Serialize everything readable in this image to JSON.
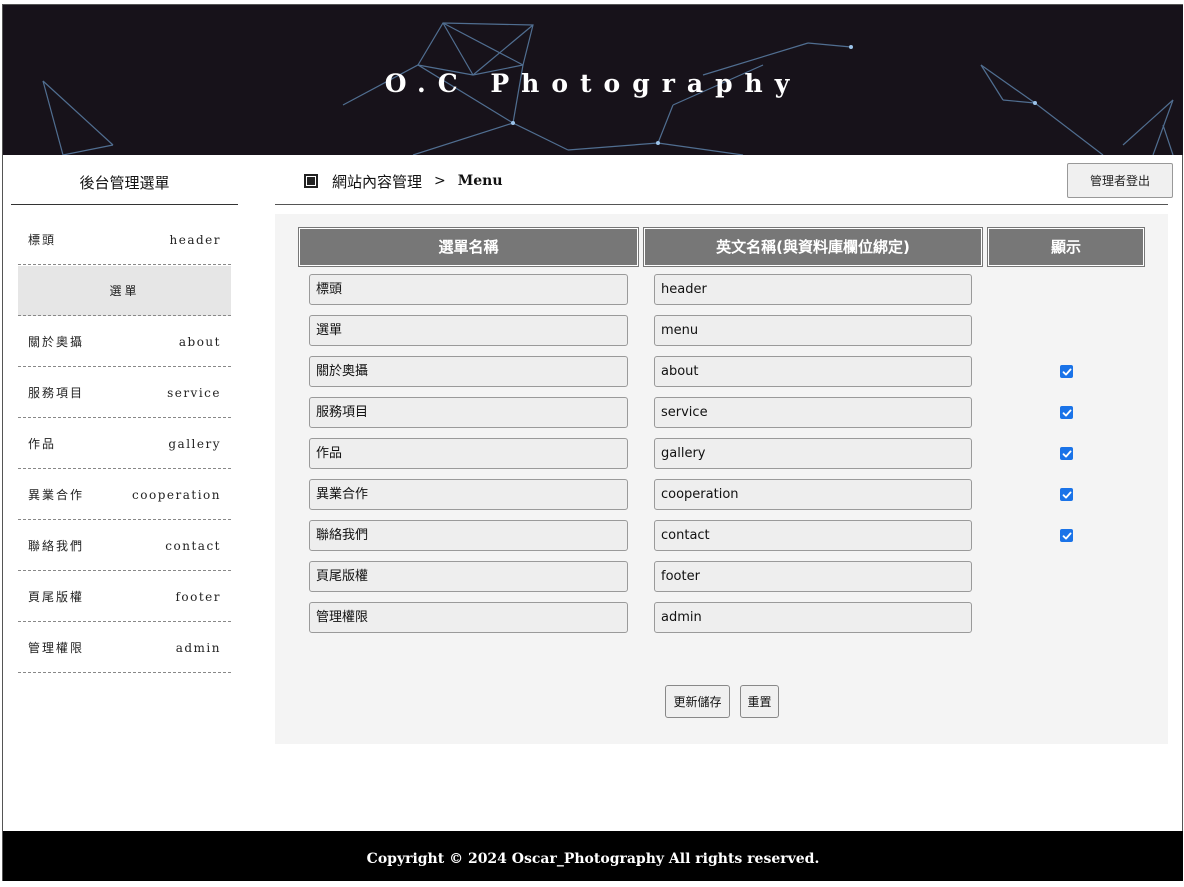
{
  "site": {
    "title": "O.C Photography"
  },
  "sidebar": {
    "title": "後台管理選單",
    "items": [
      {
        "zh": "標頭",
        "en": "header",
        "active": false
      },
      {
        "zh": "選單",
        "en": "",
        "active": true
      },
      {
        "zh": "關於奧攝",
        "en": "about",
        "active": false
      },
      {
        "zh": "服務項目",
        "en": "service",
        "active": false
      },
      {
        "zh": "作品",
        "en": "gallery",
        "active": false
      },
      {
        "zh": "異業合作",
        "en": "cooperation",
        "active": false
      },
      {
        "zh": "聯絡我們",
        "en": "contact",
        "active": false
      },
      {
        "zh": "頁尾版權",
        "en": "footer",
        "active": false
      },
      {
        "zh": "管理權限",
        "en": "admin",
        "active": false
      }
    ]
  },
  "breadcrumb": {
    "section": "網站內容管理",
    "separator": ">",
    "current": "Menu"
  },
  "header_actions": {
    "logout_label": "管理者登出"
  },
  "table": {
    "headers": [
      "選單名稱",
      "英文名稱(與資料庫欄位綁定)",
      "顯示"
    ],
    "rows": [
      {
        "name": "標頭",
        "en": "header",
        "show": null
      },
      {
        "name": "選單",
        "en": "menu",
        "show": null
      },
      {
        "name": "關於奧攝",
        "en": "about",
        "show": true
      },
      {
        "name": "服務項目",
        "en": "service",
        "show": true
      },
      {
        "name": "作品",
        "en": "gallery",
        "show": true
      },
      {
        "name": "異業合作",
        "en": "cooperation",
        "show": true
      },
      {
        "name": "聯絡我們",
        "en": "contact",
        "show": true
      },
      {
        "name": "頁尾版權",
        "en": "footer",
        "show": null
      },
      {
        "name": "管理權限",
        "en": "admin",
        "show": null
      }
    ]
  },
  "actions": {
    "save_label": "更新儲存",
    "reset_label": "重置"
  },
  "footer": {
    "copyright": "Copyright © 2024 Oscar_Photography All rights reserved."
  },
  "colors": {
    "header_bg": "#17121a",
    "accent_checkbox": "#1a73e8",
    "column_header_bg": "#777777"
  }
}
